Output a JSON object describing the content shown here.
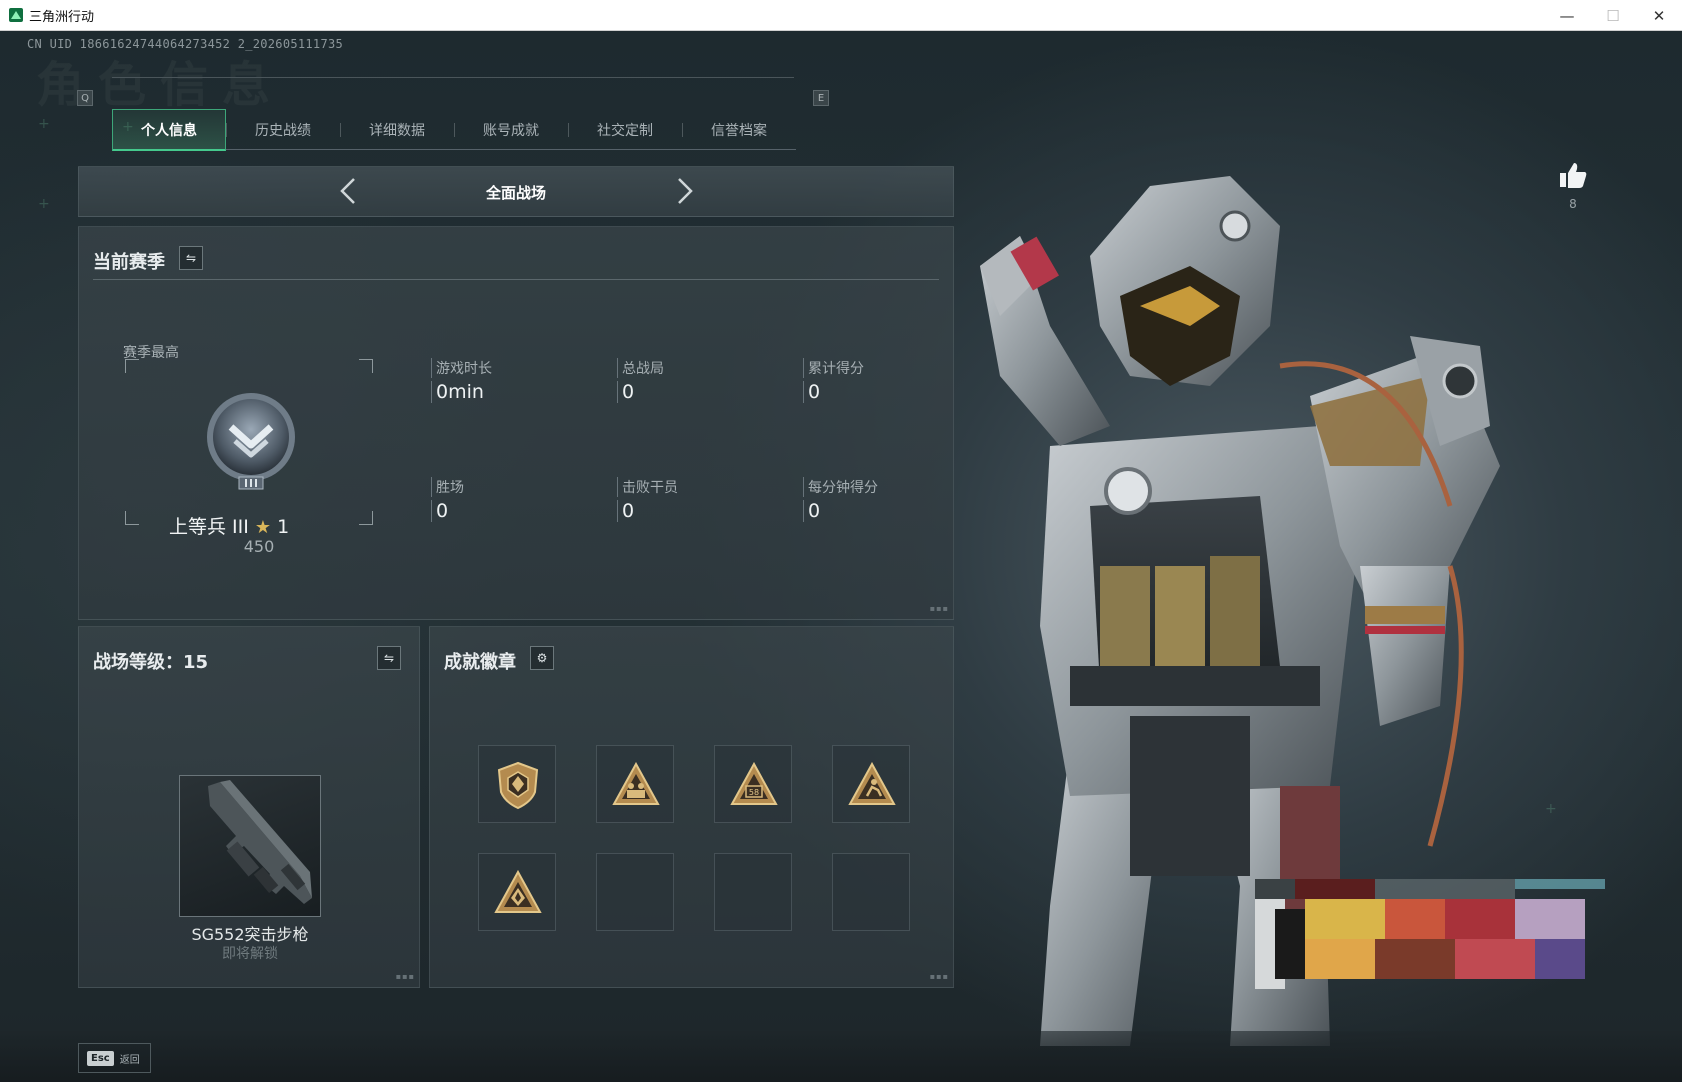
{
  "window": {
    "title": "三角洲行动",
    "min_glyph": "—",
    "max_glyph": "☐",
    "close_glyph": "✕"
  },
  "uid": "CN UID 18661624744064273452 2_202605111735",
  "ghost_title": "角色信息",
  "tabs": {
    "left_key": "Q",
    "right_key": "E",
    "items": [
      {
        "label": "个人信息",
        "active": true
      },
      {
        "label": "历史战绩",
        "active": false
      },
      {
        "label": "详细数据",
        "active": false
      },
      {
        "label": "账号成就",
        "active": false
      },
      {
        "label": "社交定制",
        "active": false
      },
      {
        "label": "信誉档案",
        "active": false
      }
    ]
  },
  "mode_selector": {
    "label": "全面战场"
  },
  "season": {
    "title": "当前赛季",
    "swap_glyph": "⇋",
    "season_best_label": "赛季最高",
    "rank": {
      "name": "上等兵 III",
      "star_glyph": "★",
      "stars": "1",
      "points": "450"
    },
    "stats": [
      {
        "label": "游戏时长",
        "value": "0min"
      },
      {
        "label": "总战局",
        "value": "0"
      },
      {
        "label": "累计得分",
        "value": "0"
      },
      {
        "label": "胜场",
        "value": "0"
      },
      {
        "label": "击败干员",
        "value": "0"
      },
      {
        "label": "每分钟得分",
        "value": "0"
      }
    ]
  },
  "level": {
    "title": "战场等级：15",
    "swap_glyph": "⇋",
    "weapon_name": "SG552突击步枪",
    "weapon_status": "即将解锁"
  },
  "badges": {
    "title": "成就徽章",
    "gear_glyph": "⚙",
    "slots": [
      {
        "icon": "shield-emblem-badge",
        "filled": true
      },
      {
        "icon": "triangle-squad-badge",
        "filled": true
      },
      {
        "icon": "triangle-58-badge",
        "filled": true,
        "text": "58"
      },
      {
        "icon": "triangle-runner-badge",
        "filled": true
      },
      {
        "icon": "triangle-diamond-badge",
        "filled": true
      },
      {
        "icon": "empty-slot",
        "filled": false
      },
      {
        "icon": "empty-slot",
        "filled": false
      },
      {
        "icon": "empty-slot",
        "filled": false
      }
    ]
  },
  "likes": {
    "count": "8"
  },
  "footer": {
    "esc_key": "Esc",
    "back_label": "返回"
  },
  "colors": {
    "accent_green": "#45c98d",
    "badge_gold": "#c9a45c",
    "rank_star": "#d9b65a"
  }
}
